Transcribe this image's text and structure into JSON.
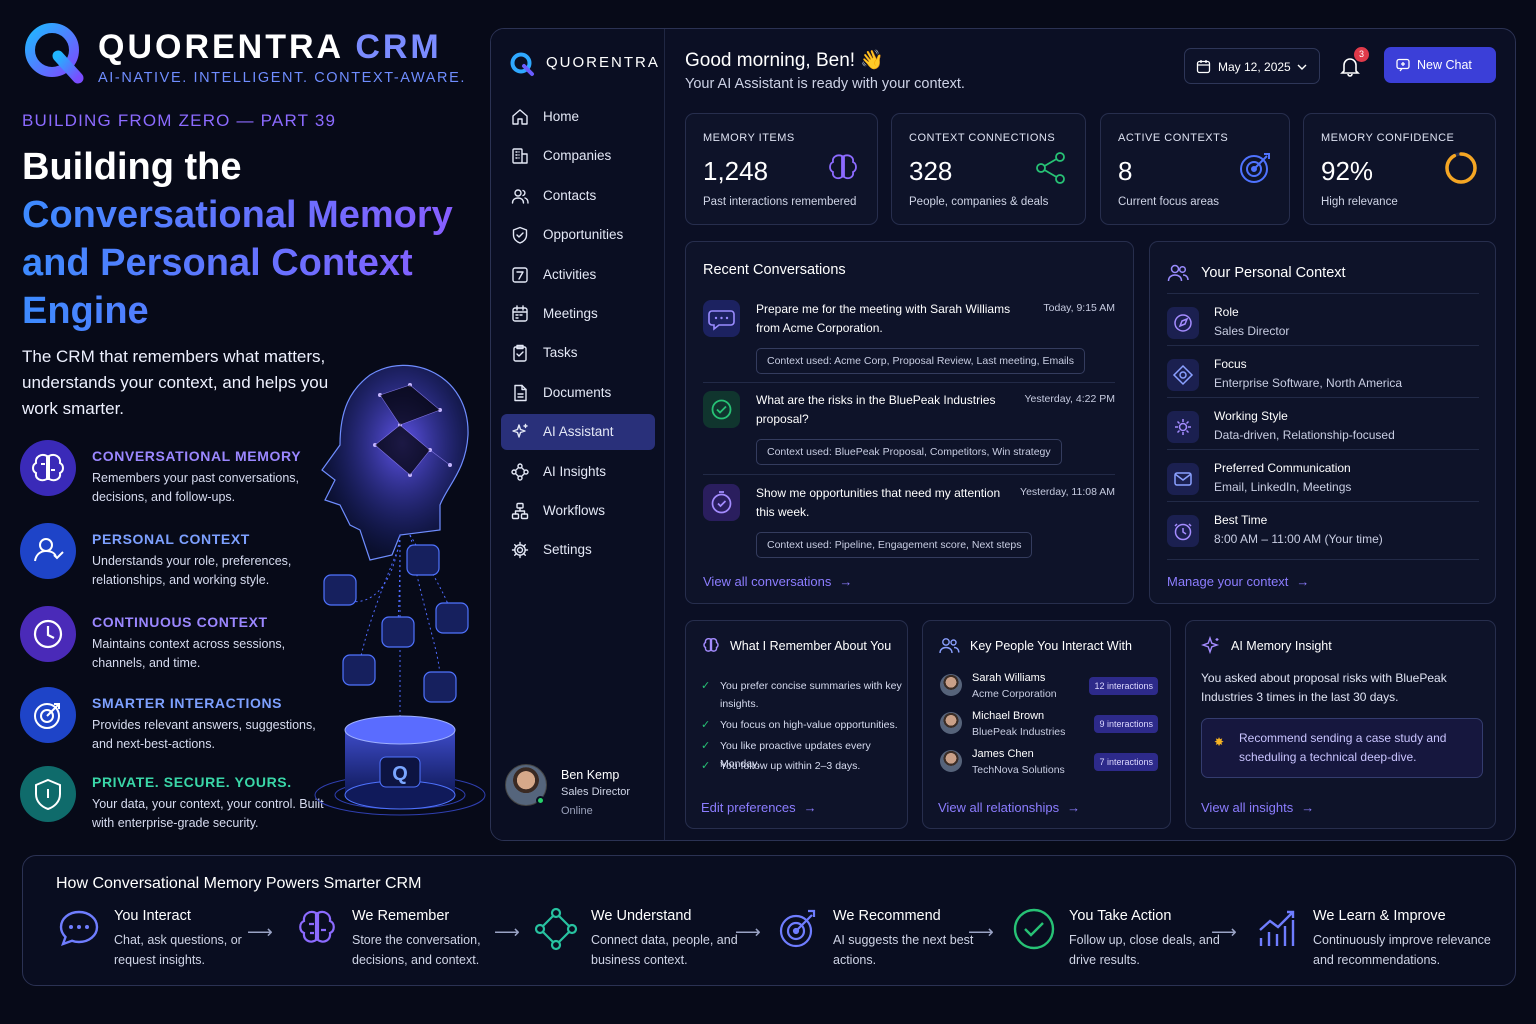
{
  "promo": {
    "brand_name": "QUORENTRA",
    "brand_suffix": "CRM",
    "tagline": "AI-NATIVE. INTELLIGENT. CONTEXT-AWARE.",
    "kicker": "BUILDING FROM ZERO — PART 39",
    "headline_line1": "Building the",
    "headline_line2": "Conversational Memory",
    "headline_line3": "and Personal Context",
    "headline_line4": "Engine",
    "subtitle": "The CRM that remembers what matters, understands your context, and helps you work smarter.",
    "features": [
      {
        "title": "CONVERSATIONAL MEMORY",
        "desc": "Remembers your past conversations, decisions, and follow-ups.",
        "color": "#9b87ff"
      },
      {
        "title": "PERSONAL CONTEXT",
        "desc": "Understands your role, preferences, relationships, and working style.",
        "color": "#7da0ff"
      },
      {
        "title": "CONTINUOUS CONTEXT",
        "desc": "Maintains context across sessions, channels, and time.",
        "color": "#9b87ff"
      },
      {
        "title": "SMARTER INTERACTIONS",
        "desc": "Provides relevant answers, suggestions, and next-best-actions.",
        "color": "#7da0ff"
      },
      {
        "title": "PRIVATE. SECURE. YOURS.",
        "desc": "Your data, your context, your control. Built with enterprise-grade security.",
        "color": "#3ad7a8"
      }
    ]
  },
  "sidebar": {
    "brand": "QUORENTRA",
    "items": [
      {
        "label": "Home",
        "icon": "home-icon"
      },
      {
        "label": "Companies",
        "icon": "building-icon"
      },
      {
        "label": "Contacts",
        "icon": "users-icon"
      },
      {
        "label": "Opportunities",
        "icon": "shield-icon"
      },
      {
        "label": "Activities",
        "icon": "activity-icon"
      },
      {
        "label": "Meetings",
        "icon": "calendar-icon"
      },
      {
        "label": "Tasks",
        "icon": "clipboard-check-icon"
      },
      {
        "label": "Documents",
        "icon": "document-icon"
      },
      {
        "label": "AI Assistant",
        "icon": "sparkle-icon"
      },
      {
        "label": "AI Insights",
        "icon": "network-icon"
      },
      {
        "label": "Workflows",
        "icon": "workflow-icon"
      },
      {
        "label": "Settings",
        "icon": "gear-icon"
      }
    ],
    "active": "AI Assistant",
    "user": {
      "name": "Ben Kemp",
      "role": "Sales Director",
      "status": "Online"
    }
  },
  "header": {
    "greeting": "Good morning, Ben! 👋",
    "subtitle": "Your AI Assistant is ready with your context.",
    "date": "May 12, 2025",
    "notifications": "3",
    "new_chat": "New Chat"
  },
  "stats": [
    {
      "label": "MEMORY ITEMS",
      "value": "1,248",
      "desc": "Past interactions remembered",
      "icon": "brain-icon"
    },
    {
      "label": "CONTEXT CONNECTIONS",
      "value": "328",
      "desc": "People, companies & deals",
      "icon": "share-icon"
    },
    {
      "label": "ACTIVE CONTEXTS",
      "value": "8",
      "desc": "Current focus areas",
      "icon": "target-icon"
    },
    {
      "label": "MEMORY CONFIDENCE",
      "value": "92%",
      "desc": "High relevance",
      "icon": "progress-ring-icon",
      "progress": 0.92
    }
  ],
  "recent": {
    "title": "Recent Conversations",
    "items": [
      {
        "question": "Prepare me for the meeting with Sarah Williams from Acme Corporation.",
        "time": "Today, 9:15 AM",
        "context": "Context used:  Acme Corp, Proposal Review, Last meeting, Emails"
      },
      {
        "question": "What are the risks in the BluePeak Industries proposal?",
        "time": "Yesterday, 4:22 PM",
        "context": "Context used:  BluePeak Proposal, Competitors, Win strategy"
      },
      {
        "question": "Show me opportunities that need my attention this week.",
        "time": "Yesterday, 11:08 AM",
        "context": "Context used:  Pipeline, Engagement score, Next steps"
      }
    ],
    "link": "View all conversations"
  },
  "personal": {
    "title": "Your Personal Context",
    "items": [
      {
        "label": "Role",
        "value": "Sales Director"
      },
      {
        "label": "Focus",
        "value": "Enterprise Software, North America"
      },
      {
        "label": "Working Style",
        "value": "Data-driven, Relationship-focused"
      },
      {
        "label": "Preferred Communication",
        "value": "Email, LinkedIn, Meetings"
      },
      {
        "label": "Best Time",
        "value": "8:00 AM – 11:00 AM (Your time)"
      }
    ],
    "link": "Manage your context"
  },
  "remember": {
    "title": "What I Remember About You",
    "items": [
      "You prefer concise summaries with key insights.",
      "You focus on high-value opportunities.",
      "You like proactive updates every Monday.",
      "You follow up within 2–3 days."
    ],
    "link": "Edit preferences"
  },
  "people": {
    "title": "Key People You Interact With",
    "items": [
      {
        "name": "Sarah Williams",
        "company": "Acme Corporation",
        "badge": "12 interactions"
      },
      {
        "name": "Michael Brown",
        "company": "BluePeak Industries",
        "badge": "9 interactions"
      },
      {
        "name": "James Chen",
        "company": "TechNova Solutions",
        "badge": "7 interactions"
      }
    ],
    "link": "View all relationships"
  },
  "insight": {
    "title": "AI Memory Insight",
    "text": "You asked about proposal risks with BluePeak Industries 3 times in the last 30 days.",
    "recommendation": "Recommend sending a case study and scheduling a technical deep-dive.",
    "link": "View all insights"
  },
  "flow": {
    "title": "How Conversational Memory Powers Smarter CRM",
    "steps": [
      {
        "title": "You Interact",
        "desc": "Chat, ask questions, or request insights."
      },
      {
        "title": "We Remember",
        "desc": "Store the conversation, decisions, and context."
      },
      {
        "title": "We Understand",
        "desc": "Connect data, people, and business context."
      },
      {
        "title": "We Recommend",
        "desc": "AI suggests the next best actions."
      },
      {
        "title": "You Take Action",
        "desc": "Follow up, close deals, and drive results."
      },
      {
        "title": "We Learn & Improve",
        "desc": "Continuously improve relevance and recommendations."
      }
    ]
  },
  "colors": {
    "accent": "#3b3fd8",
    "purple": "#8c7dff",
    "green": "#27c275"
  }
}
